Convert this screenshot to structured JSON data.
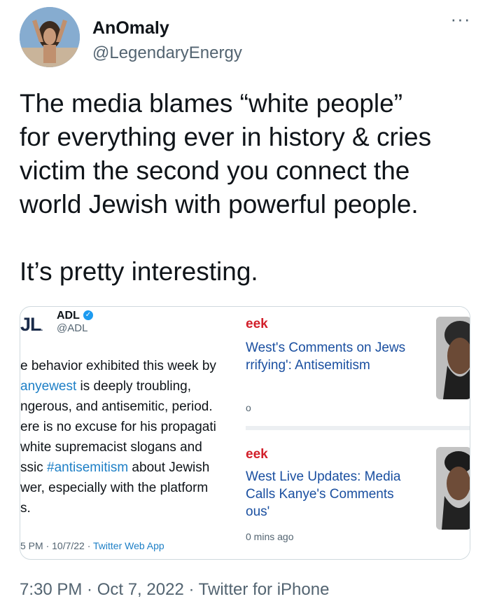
{
  "tweet": {
    "display_name": "AnOmaly",
    "handle": "@LegendaryEnergy",
    "text": "The media blames “white people”\nfor everything ever in history & cries\nvictim the second you connect the\nworld Jewish with powerful people.\n\nIt’s pretty interesting.",
    "more_label": "···",
    "timestamp": "7:30 PM · Oct 7, 2022 · Twitter for iPhone"
  },
  "embedded": {
    "logo": "JL",
    "name": "ADL",
    "handle": "@ADL",
    "lines": [
      {
        "parts": [
          {
            "text": "e behavior exhibited this week by",
            "link": false
          }
        ]
      },
      {
        "parts": [
          {
            "text": "anyewest",
            "link": true
          },
          {
            "text": " is deeply troubling,",
            "link": false
          }
        ]
      },
      {
        "parts": [
          {
            "text": "ngerous, and antisemitic, period.",
            "link": false
          }
        ]
      },
      {
        "parts": [
          {
            "text": "ere is no excuse for his propagati",
            "link": false
          }
        ]
      },
      {
        "parts": [
          {
            "text": "white supremacist slogans and",
            "link": false
          }
        ]
      },
      {
        "parts": [
          {
            "text": "ssic ",
            "link": false
          },
          {
            "text": "#antisemitism",
            "link": true
          },
          {
            "text": " about Jewish",
            "link": false
          }
        ]
      },
      {
        "parts": [
          {
            "text": "wer, especially with the platform",
            "link": false
          }
        ]
      },
      {
        "parts": [
          {
            "text": "s.",
            "link": false
          }
        ]
      }
    ],
    "meta_time": "5 PM · 10/7/22 · ",
    "meta_app": "Twitter Web App"
  },
  "news": [
    {
      "source": "eek",
      "headline": "West's Comments on Jews\nrrifying': Antisemitism",
      "meta": "o"
    },
    {
      "source": "eek",
      "headline": "West Live Updates: Media\nCalls Kanye's Comments\nous'",
      "meta": "0 mins ago"
    }
  ]
}
